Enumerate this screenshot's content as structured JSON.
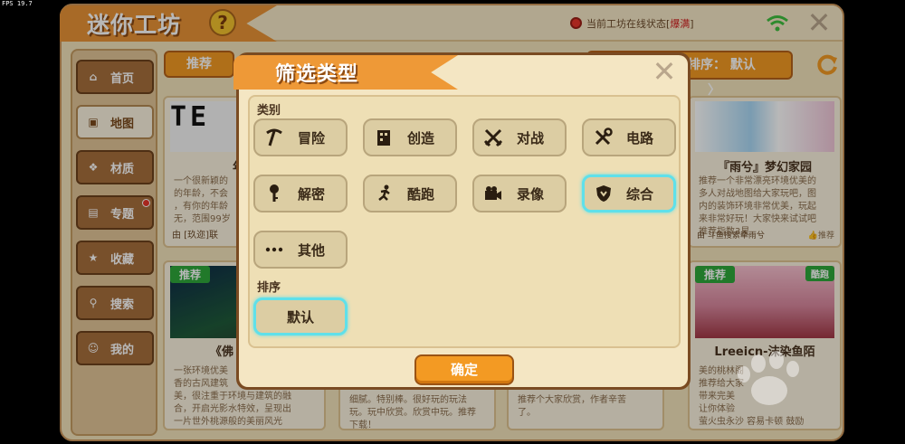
{
  "fps": "FPS 19.7",
  "header": {
    "title": "迷你工坊",
    "help": "?",
    "status_label": "当前工坊在线状态",
    "status_value": "爆满",
    "close": "✕"
  },
  "sidebar": {
    "items": [
      {
        "label": "首页",
        "icon": "home-icon"
      },
      {
        "label": "地图",
        "icon": "map-icon"
      },
      {
        "label": "材质",
        "icon": "material-icon"
      },
      {
        "label": "专题",
        "icon": "topic-icon"
      },
      {
        "label": "收藏",
        "icon": "star-icon"
      },
      {
        "label": "搜索",
        "icon": "search-icon"
      },
      {
        "label": "我的",
        "icon": "user-icon"
      }
    ]
  },
  "tabs": {
    "recommend": "推荐"
  },
  "sort": {
    "label": "排序：",
    "value": "默认",
    "arrow": "〉"
  },
  "cards": {
    "c1": {
      "image_text": "TE",
      "title": "年龄",
      "desc": "一个很新颖的\n的年龄，不会\n，有你的年龄\n无，范围99岁",
      "author": "由 [玖迩]联"
    },
    "c2": {
      "title": "『雨兮』梦幻家园",
      "desc": "推荐一个非常漂亮环境优美的\n多人对战地图给大家玩吧，图\n内的装饰环境非常优美，玩起\n来非常好玩！大家快来试试吧\n推荐指数3星",
      "author": "由 斗鱼搜索牵雨兮",
      "like": "推荐"
    },
    "c3": {
      "tag": "推荐",
      "title": "《佛",
      "desc": "一张环境优美\n香的古风建筑\n美，很注重于环境与建筑的融\n合，开启光影水特效，呈现出\n一片世外桃源般的美丽风光"
    },
    "c4": {
      "desc": "细腻。特别棒。很好玩的玩法\n玩。玩中欣赏。欣赏中玩。推荐\n下载！"
    },
    "c5": {
      "desc": "推荐个大家欣赏，作者辛苦\n了。"
    },
    "c6": {
      "tag": "推荐",
      "tag2": "酷跑",
      "title": "Lreeicn-沫染鱼陌",
      "desc": "美的桃林阁\n推荐给大家\n带来完美\n让你体验\n萤火虫永沙 容易卡顿 鼓励"
    }
  },
  "dialog": {
    "title": "筛选类型",
    "close": "✕",
    "category_label": "类别",
    "categories": [
      {
        "label": "冒险",
        "icon": "pickaxe-icon"
      },
      {
        "label": "创造",
        "icon": "cube-icon"
      },
      {
        "label": "对战",
        "icon": "crossed-swords-icon"
      },
      {
        "label": "电路",
        "icon": "tools-icon"
      },
      {
        "label": "解密",
        "icon": "key-icon"
      },
      {
        "label": "酷跑",
        "icon": "running-icon"
      },
      {
        "label": "录像",
        "icon": "camera-icon"
      },
      {
        "label": "综合",
        "icon": "shield-icon"
      },
      {
        "label": "其他",
        "icon": "dots-icon"
      }
    ],
    "selected_category": "综合",
    "sort_label": "排序",
    "sort_options": [
      {
        "label": "默认"
      }
    ],
    "selected_sort": "默认",
    "confirm": "确定"
  },
  "colors": {
    "accent_orange": "#f39a23",
    "panel_bg": "#f3e3bb",
    "selected_outline": "#5fe0ea",
    "status_red": "#e8352a",
    "tag_green": "#2fa83b"
  }
}
